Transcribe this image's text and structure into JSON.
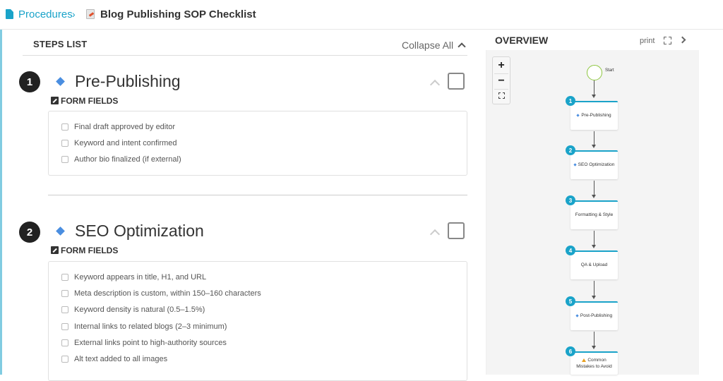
{
  "breadcrumb": {
    "root_label": "Procedures",
    "separator": "›",
    "title": "Blog Publishing SOP Checklist"
  },
  "steps_list": {
    "heading": "STEPS LIST",
    "collapse_all_label": "Collapse All",
    "form_fields_label": "FORM FIELDS",
    "steps": [
      {
        "number": "1",
        "title": "Pre-Publishing",
        "fields": [
          "Final draft approved by editor",
          "Keyword and intent confirmed",
          "Author bio finalized (if external)"
        ]
      },
      {
        "number": "2",
        "title": "SEO Optimization",
        "fields": [
          "Keyword appears in title, H1, and URL",
          "Meta description is custom, within 150–160 characters",
          "Keyword density is natural (0.5–1.5%)",
          "Internal links to related blogs (2–3 minimum)",
          "External links point to high-authority sources",
          "Alt text added to all images"
        ]
      }
    ]
  },
  "overview": {
    "heading": "OVERVIEW",
    "print_label": "print",
    "zoom_in_label": "+",
    "zoom_out_label": "−",
    "start_label": "Start",
    "nodes": [
      {
        "number": "1",
        "label": "Pre-Publishing",
        "marker": "diamond"
      },
      {
        "number": "2",
        "label": "SEO Optimization",
        "marker": "diamond"
      },
      {
        "number": "3",
        "label": "Formatting & Style",
        "marker": "none"
      },
      {
        "number": "4",
        "label": "QA & Upload",
        "marker": "none"
      },
      {
        "number": "5",
        "label": "Post-Publishing",
        "marker": "diamond"
      },
      {
        "number": "6",
        "label": "Common Mistakes to Avoid",
        "marker": "warning"
      }
    ]
  },
  "colors": {
    "accent": "#1aa3c9",
    "diamond": "#4a8ee0",
    "start_ring": "#8dc63f",
    "warning": "#e8a020"
  }
}
